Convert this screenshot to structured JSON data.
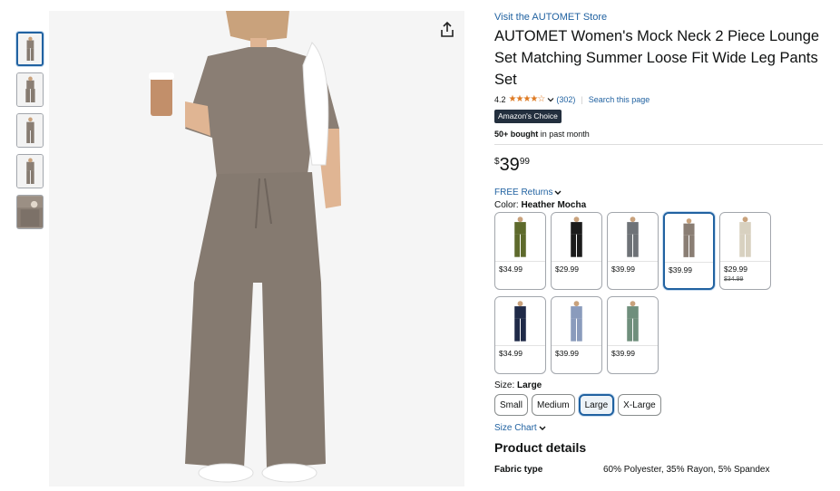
{
  "store_link": "Visit the AUTOMET Store",
  "title": "AUTOMET Women's Mock Neck 2 Piece Lounge Set Matching Summer Loose Fit Wide Leg Pants Set",
  "rating": {
    "value": "4.2",
    "stars": "★★★★☆",
    "count": "(302)",
    "search_page": "Search this page"
  },
  "badge": "Amazon's Choice",
  "bought": {
    "bold": "50+ bought",
    "rest": " in past month"
  },
  "price": {
    "symbol": "$",
    "whole": "39",
    "fraction": "99"
  },
  "returns": "FREE Returns",
  "color": {
    "label": "Color: ",
    "value": "Heather Mocha"
  },
  "swatches": [
    {
      "color": "#5e6a2c",
      "price": "$34.99",
      "old": ""
    },
    {
      "color": "#1b1b1b",
      "price": "$29.99",
      "old": ""
    },
    {
      "color": "#6e7277",
      "price": "$39.99",
      "old": ""
    },
    {
      "color": "#8a7e74",
      "price": "$39.99",
      "old": ""
    },
    {
      "color": "#d8d1c0",
      "price": "$29.99",
      "old": "$34.99"
    },
    {
      "color": "#1f2a48",
      "price": "$34.99",
      "old": ""
    },
    {
      "color": "#8a9bbc",
      "price": "$39.99",
      "old": ""
    },
    {
      "color": "#6f8f7c",
      "price": "$39.99",
      "old": ""
    }
  ],
  "size": {
    "label": "Size: ",
    "value": "Large"
  },
  "sizes": [
    "Small",
    "Medium",
    "Large",
    "X-Large"
  ],
  "size_chart": "Size Chart",
  "details_heading": "Product details",
  "details": [
    {
      "key": "Fabric type",
      "value": "60% Polyester, 35% Rayon, 5% Spandex"
    }
  ],
  "colors": {
    "link": "#2162a1",
    "selected_border": "#2162a1",
    "star": "#de7921",
    "badge_bg": "#232f3e"
  },
  "icons": {
    "share": "share-icon",
    "chevron": "chevron-down-icon"
  }
}
